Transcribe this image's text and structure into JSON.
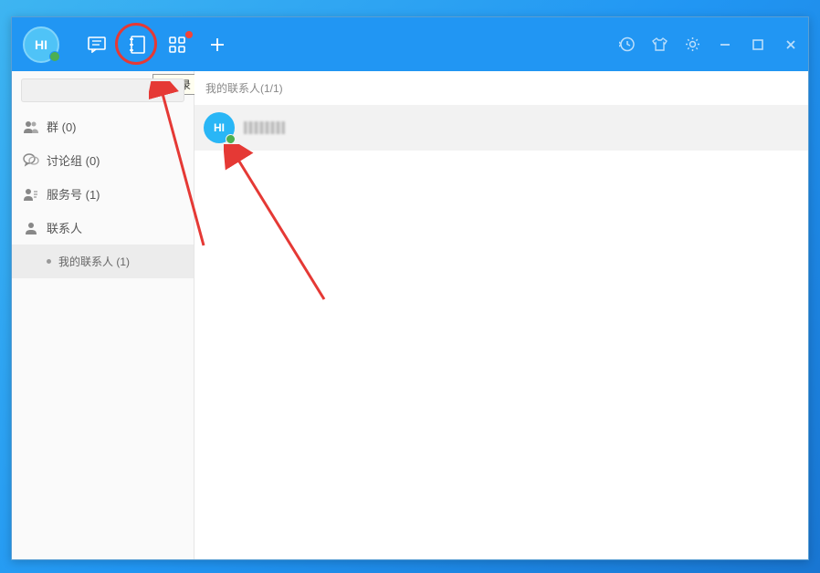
{
  "logo": {
    "text": "HI"
  },
  "tooltip": {
    "label": "通讯录"
  },
  "sidebar": {
    "search": {
      "placeholder": ""
    },
    "categories": [
      {
        "label": "群 (0)"
      },
      {
        "label": "讨论组 (0)"
      },
      {
        "label": "服务号 (1)"
      },
      {
        "label": "联系人"
      }
    ],
    "subcategory": {
      "label": "我的联系人 (1)"
    }
  },
  "content": {
    "header": "我的联系人(1/1)",
    "contact": {
      "avatar_text": "HI"
    }
  }
}
